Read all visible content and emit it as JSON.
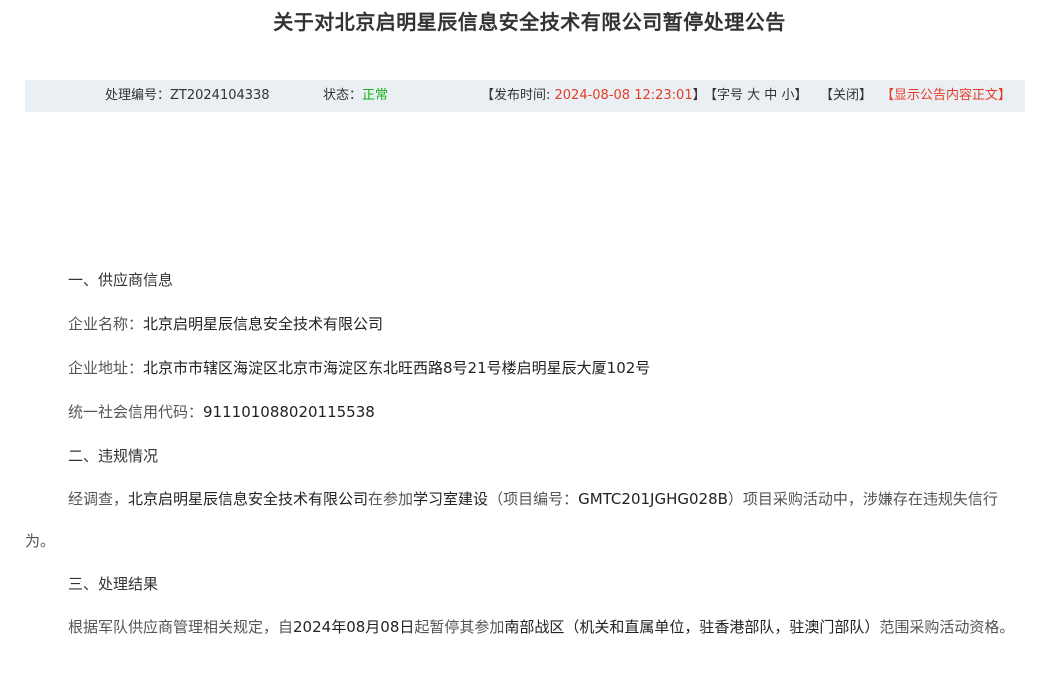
{
  "title": "关于对北京启明星辰信息安全技术有限公司暂停处理公告",
  "infobar": {
    "code_label": "处理编号：",
    "code_value": "ZT2024104338",
    "status_label": "状态：",
    "status_value": "正常",
    "publish_open": "【发布时间: ",
    "publish_value": "2024-08-08 12:23:01",
    "publish_close": "】",
    "font_open": "【字号 ",
    "font_large": "大",
    "font_medium": "中",
    "font_small": "小",
    "font_close": "】",
    "close_label": "【关闭】",
    "show_body_label": "【显示公告内容正文】"
  },
  "content": {
    "section1_heading": "一、供应商信息",
    "company_name_label": "企业名称：",
    "company_name_value": "北京启明星辰信息安全技术有限公司",
    "company_address_label": "企业地址：",
    "company_address_value": "北京市市辖区海淀区北京市海淀区东北旺西路8号21号楼启明星辰大厦102号",
    "credit_code_label": "统一社会信用代码：",
    "credit_code_value": "911101088020115538",
    "section2_heading": "二、违规情况",
    "violation_p1": "经调查，",
    "violation_company": "北京启明星辰信息安全技术有限公司",
    "violation_p2": "在参加",
    "violation_project": "学习室建设",
    "violation_p3": "（项目编号：",
    "violation_project_code": "GMTC201JGHG028B",
    "violation_p4": "）项目采购活动中，涉嫌存在违规失信行为。",
    "section3_heading": "三、处理结果",
    "result_p1": "根据军队供应商管理相关规定，自",
    "result_date": "2024年08月08日",
    "result_p2": "起暂停其参加",
    "result_scope": "南部战区（机关和直属单位，驻香港部队，驻澳门部队）",
    "result_p3": "范围采购活动资格。"
  },
  "colors": {
    "accent_red": "#e53c28",
    "status_green": "#13b013",
    "infobar_bg": "#eaeff3"
  }
}
